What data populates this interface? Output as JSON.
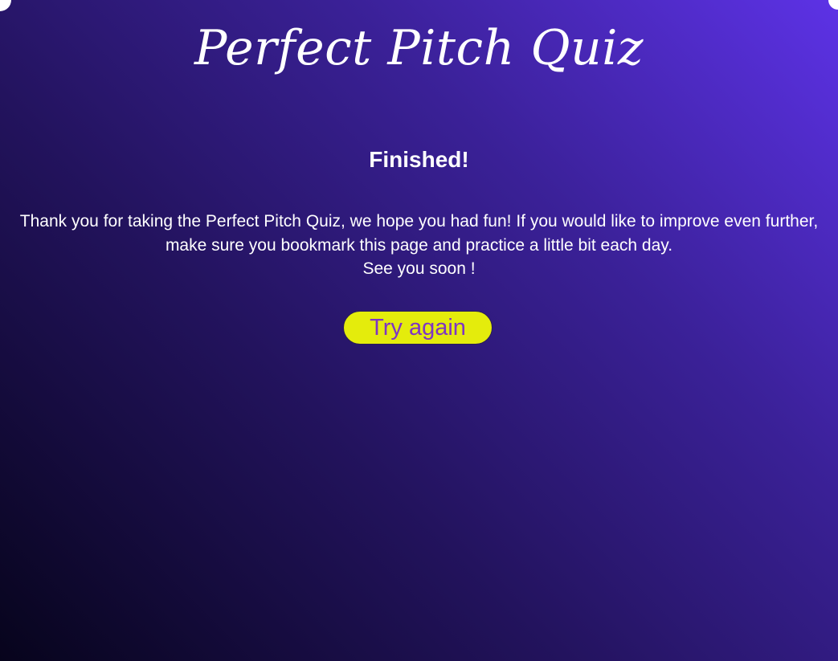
{
  "app": {
    "title": "Perfect Pitch Quiz"
  },
  "result": {
    "heading": "Finished!",
    "message_line1": "Thank you for taking the Perfect Pitch Quiz, we hope you had fun! If you would like to improve even further, make sure you bookmark this page and practice a little bit each day.",
    "message_line2": "See you soon !"
  },
  "actions": {
    "try_again_label": "Try again"
  },
  "colors": {
    "background_start": "#07041c",
    "background_end": "#5d32e6",
    "button_fill": "#e4ec0c",
    "button_text": "#7e35c4",
    "text": "#ffffff"
  }
}
